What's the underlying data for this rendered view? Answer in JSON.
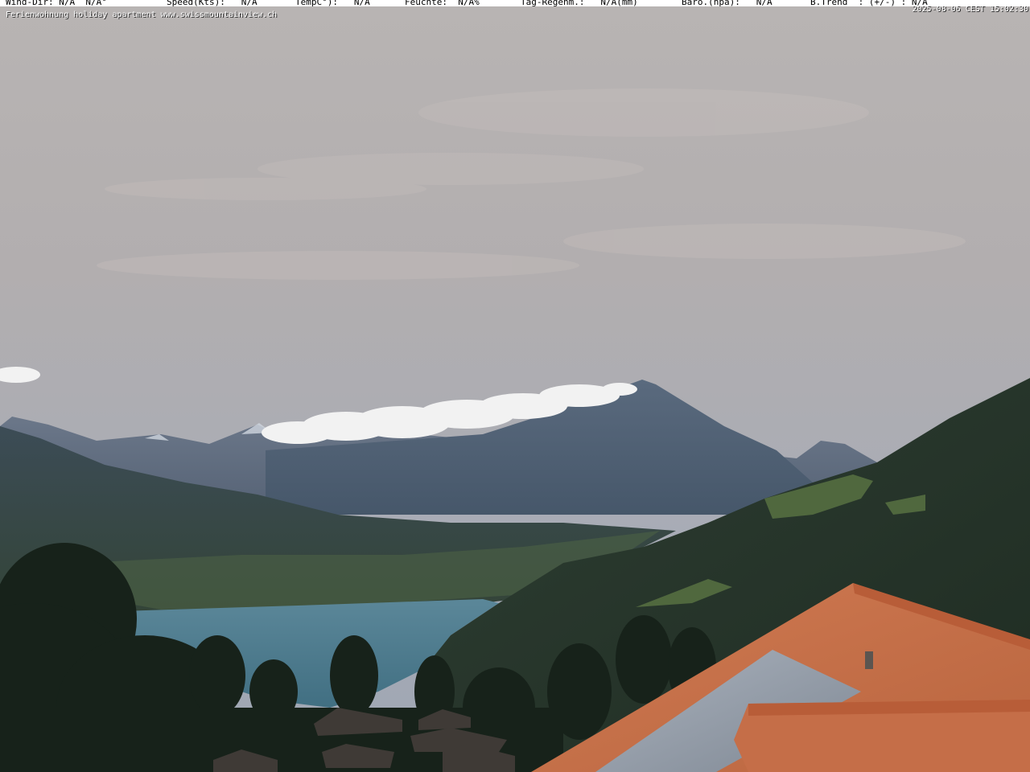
{
  "weather_bar": {
    "items": [
      "Wind-Dir: N/A  N/A°",
      "Speed(Kts):   N/A",
      "TempC°):   N/A",
      "Feuchte:  N/A%",
      "Tag-Regenm.:   N/A(mm)",
      "Baro.(hpa):   N/A",
      "B.Trend  : (+/-) : N/A"
    ]
  },
  "timestamp": "2025-08-06 CEST 15:02:30",
  "site_line": "Ferienwohnung holiday apartment www.swissmountainview.ch",
  "colors": {
    "sky_top": "#b7b3b2",
    "sky_bottom": "#a9aeb9",
    "mountain_peak": "#5d6b7f",
    "lake": "#4d7a8e",
    "forest": "#1d2a1f",
    "roof": "#c9714a"
  }
}
